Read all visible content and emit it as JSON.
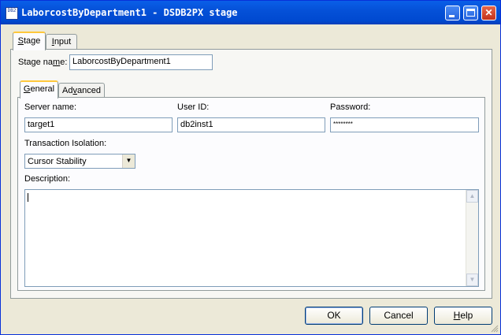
{
  "window": {
    "title": "LaborcostByDepartment1 - DSDB2PX stage",
    "icon_label": "DB2"
  },
  "outer_tabs": [
    {
      "label": "Stage",
      "mnemonic": "S",
      "active": true
    },
    {
      "label": "Input",
      "mnemonic": "I",
      "active": false
    }
  ],
  "stage_name": {
    "label": "Stage name:",
    "value": "LaborcostByDepartment1"
  },
  "inner_tabs": [
    {
      "label": "General",
      "mnemonic": "G",
      "active": true
    },
    {
      "label": "Advanced",
      "mnemonic": "v",
      "active": false
    }
  ],
  "general": {
    "server_name_label": "Server name:",
    "server_name_value": "target1",
    "user_id_label": "User ID:",
    "user_id_value": "db2inst1",
    "password_label": "Password:",
    "password_value": "********",
    "transaction_label": "Transaction Isolation:",
    "transaction_value": "Cursor Stability",
    "description_label": "Description:",
    "description_value": ""
  },
  "buttons": {
    "ok": "OK",
    "cancel": "Cancel",
    "help": "Help"
  }
}
